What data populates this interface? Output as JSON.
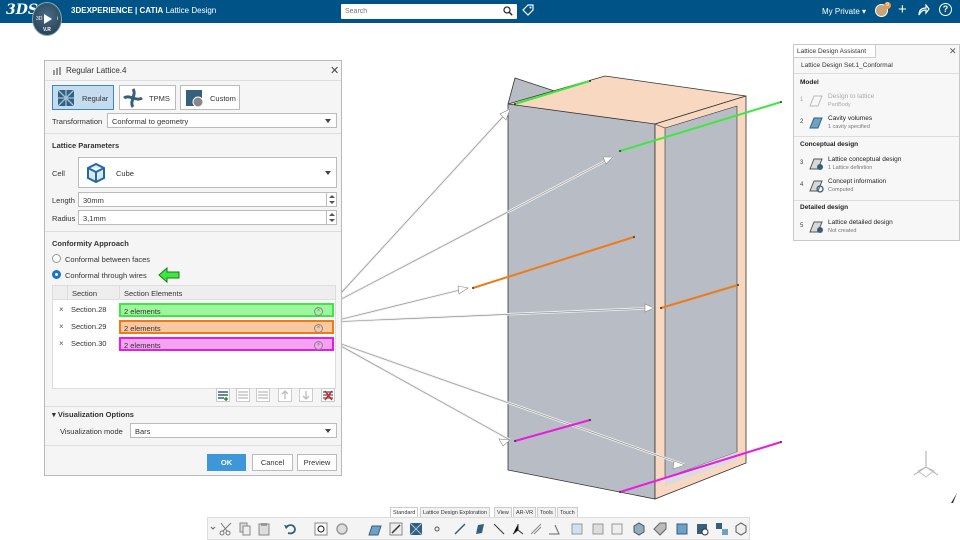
{
  "topbar": {
    "logo": "3DS",
    "compass_top": "3D",
    "compass_right": "i",
    "compass_version": "V.R",
    "brand_bold": "3DEXPERIENCE | CATIA",
    "app_name": "Lattice Design",
    "search_placeholder": "Search",
    "user_menu": "My Private",
    "notification_count": "9"
  },
  "dialog": {
    "title": "Regular Lattice.4",
    "types": [
      {
        "label": "Regular",
        "active": true
      },
      {
        "label": "TPMS",
        "active": false
      },
      {
        "label": "Custom",
        "active": false
      }
    ],
    "transformation_label": "Transformation",
    "transformation_value": "Conformal to geometry",
    "lattice_params_title": "Lattice Parameters",
    "cell_label": "Cell",
    "cell_value": "Cube",
    "length_label": "Length",
    "length_value": "30mm",
    "radius_label": "Radius",
    "radius_value": "3,1mm",
    "conformity_title": "Conformity Approach",
    "option_faces": "Conformal between faces",
    "option_wires": "Conformal through wires",
    "selected_option": "Conformal through wires",
    "table_headers": [
      "Section",
      "Section Elements"
    ],
    "rows": [
      {
        "name": "Section.28",
        "elements": "2 elements",
        "color": "#3ee83e",
        "fill": "#9ff59f"
      },
      {
        "name": "Section.29",
        "elements": "2 elements",
        "color": "#ef7a1a",
        "fill": "#f8c9a0"
      },
      {
        "name": "Section.30",
        "elements": "2 elements",
        "color": "#e81ce0",
        "fill": "#f3a3ef"
      }
    ],
    "viz_title": "Visualization Options",
    "viz_mode_label": "Visualization mode",
    "viz_mode_value": "Bars",
    "ok": "OK",
    "cancel": "Cancel",
    "preview": "Preview"
  },
  "assistant": {
    "tab": "Lattice Design Assistant",
    "set_name": "Lattice Design Set.1_Conformal",
    "sections": [
      {
        "title": "Model",
        "steps": [
          {
            "num": "1",
            "title": "Design to lattice",
            "sub": "PartBody",
            "disabled": true
          },
          {
            "num": "2",
            "title": "Cavity volumes",
            "sub": "1 cavity specified",
            "disabled": false
          }
        ]
      },
      {
        "title": "Conceptual design",
        "steps": [
          {
            "num": "3",
            "title": "Lattice conceptual design",
            "sub": "1 Lattice definition",
            "disabled": false
          },
          {
            "num": "4",
            "title": "Concept information",
            "sub": "Computed",
            "disabled": false
          }
        ]
      },
      {
        "title": "Detailed design",
        "steps": [
          {
            "num": "5",
            "title": "Lattice detailed design",
            "sub": "Not created",
            "disabled": false
          }
        ]
      }
    ]
  },
  "bottom_tabs": [
    "Standard",
    "Lattice Design Exploration",
    "View",
    "AR-VR",
    "Tools",
    "Touch"
  ],
  "active_tab": "Standard",
  "colors": {
    "topbar": "#005386",
    "accent": "#3d97d8",
    "wire_green": "#3ee83e",
    "wire_orange": "#ef7a1a",
    "wire_magenta": "#e81ce0",
    "box_grey": "#b8bcc4",
    "box_peach": "#f9d8c2"
  }
}
